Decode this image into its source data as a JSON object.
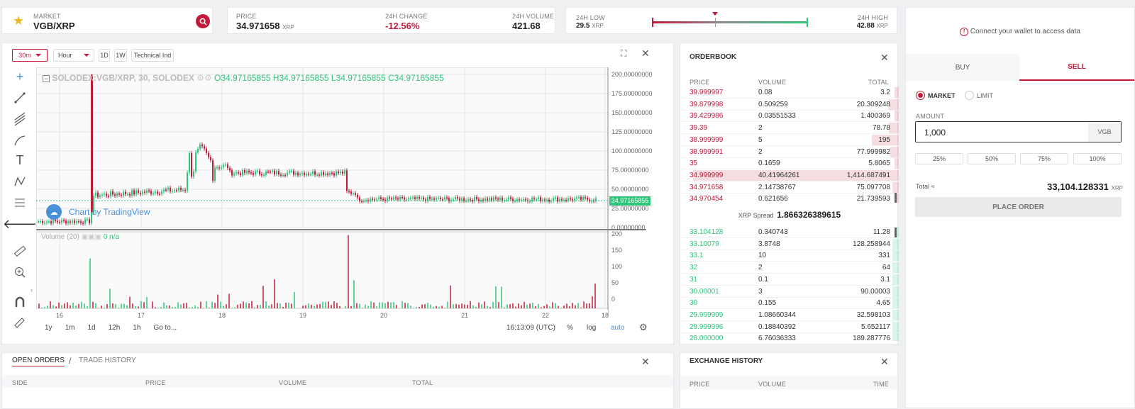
{
  "market": {
    "label": "MARKET",
    "pair": "VGB/XRP"
  },
  "stats": {
    "price_label": "PRICE",
    "price": "34.971658",
    "price_unit": "XRP",
    "change_label": "24H CHANGE",
    "change": "-12.56%",
    "volume_label": "24H VOLUME",
    "volume": "421.68"
  },
  "range": {
    "low_label": "24H LOW",
    "low": "29.5",
    "low_unit": "XRP",
    "high_label": "24H HIGH",
    "high": "42.88",
    "high_unit": "XRP",
    "position": 0.41
  },
  "colors": {
    "red": "#c41a3a",
    "green": "#2fc57a",
    "accent": "#c41a3a"
  },
  "toolbar": {
    "interval": "30m",
    "resolution": "Hour",
    "d1": "1D",
    "w1": "1W",
    "indicators": "Technical Ind"
  },
  "chart": {
    "legend_symbol": "SOLODEX:VGB/XRP, 30, SOLODEX",
    "o": "O34.97165855",
    "h": "H34.97165855",
    "l": "L34.97165855",
    "c": "C34.97165855",
    "price_tag": "34.97165855",
    "watermark": "Chart by TradingView",
    "volume_legend": "Volume (20)",
    "volume_vals": "0  n/a",
    "price_ticks": [
      "200.00000000",
      "175.00000000",
      "150.00000000",
      "125.00000000",
      "100.00000000",
      "75.00000000",
      "50.00000000",
      "25.00000000",
      "0.00000000"
    ],
    "vol_ticks": [
      "200",
      "150",
      "100",
      "50",
      "0"
    ],
    "x_ticks": [
      "16",
      "17",
      "18",
      "19",
      "20",
      "21",
      "22",
      "18"
    ]
  },
  "chart_data": {
    "type": "candlestick",
    "price_ylim": [
      0,
      210
    ],
    "volume_ylim": [
      0,
      230
    ],
    "x_labels": [
      "16",
      "17",
      "18",
      "19",
      "20",
      "21",
      "22",
      "18"
    ]
  },
  "bottom_bar": {
    "ranges": [
      "1y",
      "1m",
      "1d",
      "12h",
      "1h"
    ],
    "goto": "Go to...",
    "time": "16:13:09 (UTC)",
    "pct": "%",
    "log": "log",
    "auto": "auto"
  },
  "orderbook": {
    "title": "ORDERBOOK",
    "headers": {
      "price": "PRICE",
      "volume": "VOLUME",
      "total": "TOTAL"
    },
    "asks": [
      {
        "price": "39.999997",
        "volume": "0.08",
        "total": "3.2",
        "fill": 0.02
      },
      {
        "price": "39.879998",
        "volume": "0.509259",
        "total": "20.309248",
        "fill": 0.05
      },
      {
        "price": "39.429986",
        "volume": "0.03551533",
        "total": "1.400369",
        "fill": 0.01
      },
      {
        "price": "39.39",
        "volume": "2",
        "total": "78.78",
        "fill": 0.05
      },
      {
        "price": "38.999999",
        "volume": "5",
        "total": "195",
        "fill": 0.13
      },
      {
        "price": "38.999991",
        "volume": "2",
        "total": "77.999982",
        "fill": 0.04
      },
      {
        "price": "35",
        "volume": "0.1659",
        "total": "5.8065",
        "fill": 0.02
      },
      {
        "price": "34.999999",
        "volume": "40.41964261",
        "total": "1,414.687491",
        "fill": 1.0
      },
      {
        "price": "34.971658",
        "volume": "2.14738767",
        "total": "75.097708",
        "fill": 0.03
      },
      {
        "price": "34.970454",
        "volume": "0.621656",
        "total": "21.739593",
        "fill": 0.02
      }
    ],
    "spread_label": "XRP Spread",
    "spread": "1.866326389615",
    "bids": [
      {
        "price": "33.104128",
        "volume": "0.340743",
        "total": "11.28",
        "fill": 0.02
      },
      {
        "price": "33.10079",
        "volume": "3.8748",
        "total": "128.258944",
        "fill": 0.03
      },
      {
        "price": "33.1",
        "volume": "10",
        "total": "331",
        "fill": 0.03
      },
      {
        "price": "32",
        "volume": "2",
        "total": "64",
        "fill": 0.03
      },
      {
        "price": "31",
        "volume": "0.1",
        "total": "3.1",
        "fill": 0.03
      },
      {
        "price": "30.00001",
        "volume": "3",
        "total": "90.00003",
        "fill": 0.03
      },
      {
        "price": "30",
        "volume": "0.155",
        "total": "4.65",
        "fill": 0.03
      },
      {
        "price": "29.999999",
        "volume": "1.08660344",
        "total": "32.598103",
        "fill": 0.03
      },
      {
        "price": "29.999996",
        "volume": "0.18840392",
        "total": "5.652117",
        "fill": 0.03
      },
      {
        "price": "28.000000",
        "volume": "6.76036333",
        "total": "189.287776",
        "fill": 0.03
      }
    ]
  },
  "orders": {
    "tab_open": "OPEN ORDERS",
    "separator": "/",
    "tab_history": "TRADE HISTORY",
    "headers": {
      "side": "SIDE",
      "price": "PRICE",
      "volume": "VOLUME",
      "total": "TOTAL"
    }
  },
  "exchange": {
    "title": "EXCHANGE HISTORY",
    "headers": {
      "price": "PRICE",
      "volume": "VOLUME",
      "time": "TIME"
    }
  },
  "trade": {
    "wallet_notice": "Connect your wallet to access data",
    "buy_tab": "BUY",
    "sell_tab": "SELL",
    "market_radio": "MARKET",
    "limit_radio": "LIMIT",
    "amount_label": "AMOUNT",
    "amount_value": "1,000",
    "amount_unit": "VGB",
    "pcts": [
      "25%",
      "50%",
      "75%",
      "100%"
    ],
    "total_label": "Total ≈",
    "total_value": "33,104.128331",
    "total_unit": "XRP",
    "place_order": "PLACE ORDER"
  }
}
